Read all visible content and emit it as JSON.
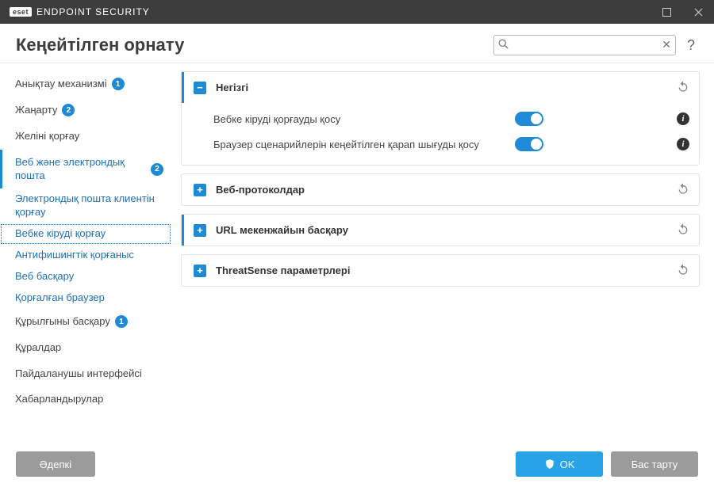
{
  "app": {
    "brand": "eset",
    "title": "ENDPOINT SECURITY"
  },
  "page": {
    "title": "Кеңейтілген орнату"
  },
  "search": {
    "placeholder": "",
    "value": ""
  },
  "sidebar": {
    "items": [
      {
        "label": "Анықтау механизмі",
        "badge": "1",
        "kind": "major"
      },
      {
        "label": "Жаңарту",
        "badge": "2",
        "kind": "major"
      },
      {
        "label": "Желіні қорғау",
        "badge": null,
        "kind": "major"
      },
      {
        "label": "Веб және электрондық пошта",
        "badge": "2",
        "kind": "major-active"
      },
      {
        "label": "Электрондық пошта клиентін қорғау",
        "badge": null,
        "kind": "sub"
      },
      {
        "label": "Вебке кіруді қорғау",
        "badge": null,
        "kind": "sub-selected"
      },
      {
        "label": "Антифишингтік қорғаныс",
        "badge": null,
        "kind": "sub"
      },
      {
        "label": "Веб басқару",
        "badge": null,
        "kind": "sub"
      },
      {
        "label": "Қорғалған браузер",
        "badge": null,
        "kind": "sub"
      },
      {
        "label": "Құрылғыны басқару",
        "badge": "1",
        "kind": "major"
      },
      {
        "label": "Құралдар",
        "badge": null,
        "kind": "major"
      },
      {
        "label": "Пайдаланушы интерфейсі",
        "badge": null,
        "kind": "major"
      },
      {
        "label": "Хабарландырулар",
        "badge": null,
        "kind": "major"
      }
    ]
  },
  "panels": [
    {
      "title": "Негізгі",
      "expanded": true,
      "settings": [
        {
          "label": "Вебке кіруді қорғауды қосу",
          "on": true
        },
        {
          "label": "Браузер сценарийлерін кеңейтілген қарап шығуды қосу",
          "on": true
        }
      ]
    },
    {
      "title": "Веб-протоколдар",
      "expanded": false
    },
    {
      "title": "URL мекенжайын басқару",
      "expanded": false
    },
    {
      "title": "ThreatSense параметрлері",
      "expanded": false
    }
  ],
  "footer": {
    "defaultLabel": "Әдепкі",
    "okLabel": "OK",
    "cancelLabel": "Бас тарту"
  },
  "glyphs": {
    "expand": "+",
    "collapse": "−",
    "help": "?",
    "clear": "✕",
    "info": "i"
  }
}
